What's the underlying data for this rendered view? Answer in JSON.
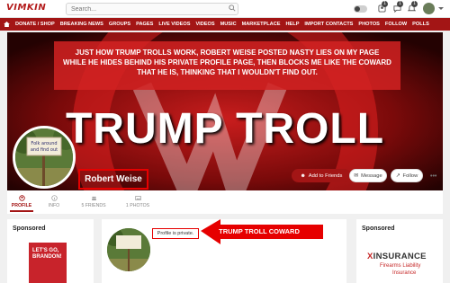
{
  "app": {
    "logo": "VIMKIN"
  },
  "search": {
    "placeholder": "Search..."
  },
  "header": {
    "badges": [
      "1",
      "1",
      "1"
    ]
  },
  "nav": {
    "items": [
      "DONATE / SHOP",
      "BREAKING NEWS",
      "GROUPS",
      "PAGES",
      "LIVE VIDEOS",
      "VIDEOS",
      "MUSIC",
      "MARKETPLACE",
      "HELP",
      "IMPORT CONTACTS",
      "PHOTOS",
      "FOLLOW",
      "POLLS"
    ]
  },
  "cover": {
    "annotation": "JUST HOW TRUMP TROLLS WORK, ROBERT WEISE POSTED NASTY LIES ON MY PAGE WHILE HE HIDES BEHIND HIS PRIVATE PROFILE PAGE, THEN BLOCKS ME LIKE THE COWARD THAT HE IS, THINKING THAT I WOULDN'T FIND OUT.",
    "headline": "TRUMP TROLL",
    "sign_text": "Folk around and find out"
  },
  "profile": {
    "name": "Robert Weise",
    "add_friend": "Add to Friends",
    "message": "Message",
    "follow": "Follow",
    "more": "•••"
  },
  "tabs": [
    {
      "label": "PROFILE"
    },
    {
      "label": "INFO"
    },
    {
      "label": "5 FRIENDS"
    },
    {
      "label": "1 PHOTOS"
    }
  ],
  "sponsored_left": {
    "title": "Sponsored",
    "book_text": "LET'S GO, BRANDON!"
  },
  "main_panel": {
    "private_label": "Profile is private.",
    "callout": "TRUMP TROLL COWARD"
  },
  "sponsored_right": {
    "title": "Sponsored",
    "logo_x": "X",
    "logo_rest": "INSURANCE",
    "line1": "Firearms Liability",
    "line2": "Insurance"
  },
  "colors": {
    "brand": "#a31515",
    "annotation_red": "#e60000"
  }
}
